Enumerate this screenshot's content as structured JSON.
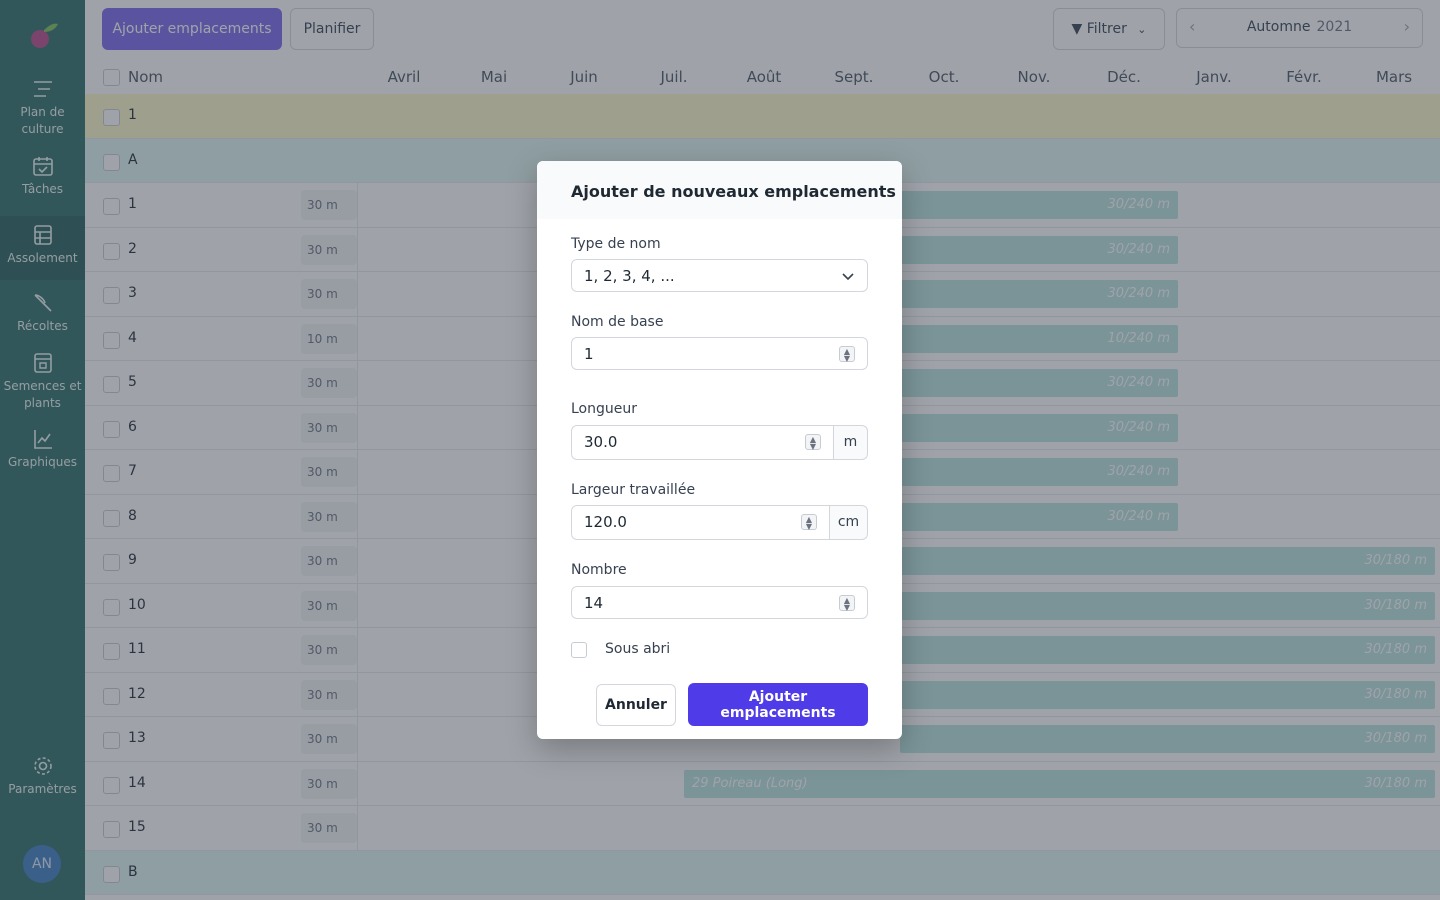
{
  "sidebar": {
    "logo_icon": "plant-logo-icon",
    "items": [
      {
        "label": "Plan de culture",
        "icon": "plan-icon"
      },
      {
        "label": "Tâches",
        "icon": "calendar-check-icon"
      },
      {
        "label": "Assolement",
        "icon": "layout-icon"
      },
      {
        "label": "Récoltes",
        "icon": "knife-icon"
      },
      {
        "label": "Semences et plants",
        "icon": "seed-box-icon"
      },
      {
        "label": "Graphiques",
        "icon": "chart-line-icon"
      }
    ],
    "settings_label": "Paramètres",
    "avatar_initials": "AN"
  },
  "toolbar": {
    "add_label": "Ajouter emplacements",
    "plan_label": "Planifier",
    "filter_label": "Filtrer",
    "season_label": "Automne",
    "season_year": "2021"
  },
  "grid": {
    "name_header": "Nom",
    "months": [
      "Avril",
      "Mai",
      "Juin",
      "Juil.",
      "Août",
      "Sept.",
      "Oct.",
      "Nov.",
      "Déc.",
      "Janv.",
      "Févr.",
      "Mars"
    ],
    "rows": [
      {
        "name": "1",
        "group": "yellow",
        "length": ""
      },
      {
        "name": "A",
        "group": "teal",
        "length": ""
      },
      {
        "name": "1",
        "group": "",
        "length": "30 m",
        "bar": "30/240 m"
      },
      {
        "name": "2",
        "group": "",
        "length": "30 m",
        "bar": "30/240 m"
      },
      {
        "name": "3",
        "group": "",
        "length": "30 m",
        "bar": "30/240 m"
      },
      {
        "name": "4",
        "group": "",
        "length": "10 m",
        "bar": "10/240 m"
      },
      {
        "name": "5",
        "group": "",
        "length": "30 m",
        "bar": "30/240 m"
      },
      {
        "name": "6",
        "group": "",
        "length": "30 m",
        "bar": "30/240 m"
      },
      {
        "name": "7",
        "group": "",
        "length": "30 m",
        "bar": "30/240 m"
      },
      {
        "name": "8",
        "group": "",
        "length": "30 m",
        "bar": "30/240 m"
      },
      {
        "name": "9",
        "group": "",
        "length": "30 m",
        "bar": "30/180 m"
      },
      {
        "name": "10",
        "group": "",
        "length": "30 m",
        "bar": "30/180 m"
      },
      {
        "name": "11",
        "group": "",
        "length": "30 m",
        "bar": "30/180 m"
      },
      {
        "name": "12",
        "group": "",
        "length": "30 m",
        "bar": "30/180 m"
      },
      {
        "name": "13",
        "group": "",
        "length": "30 m",
        "bar": "30/180 m"
      },
      {
        "name": "14",
        "group": "",
        "length": "30 m",
        "bar": "30/180 m",
        "bar_left": "29 Poireau (Long)"
      },
      {
        "name": "15",
        "group": "",
        "length": "30 m"
      },
      {
        "name": "B",
        "group": "teal",
        "length": ""
      }
    ]
  },
  "modal": {
    "title": "Ajouter de nouveaux emplacements",
    "name_type_label": "Type de nom",
    "name_type_value": "1, 2, 3, 4, ...",
    "base_name_label": "Nom de base",
    "base_name_value": "1",
    "length_label": "Longueur",
    "length_value": "30.0",
    "length_unit": "m",
    "width_label": "Largeur travaillée",
    "width_value": "120.0",
    "width_unit": "cm",
    "count_label": "Nombre",
    "count_value": "14",
    "covered_label": "Sous abri",
    "cancel_label": "Annuler",
    "submit_label": "Ajouter emplacements"
  }
}
